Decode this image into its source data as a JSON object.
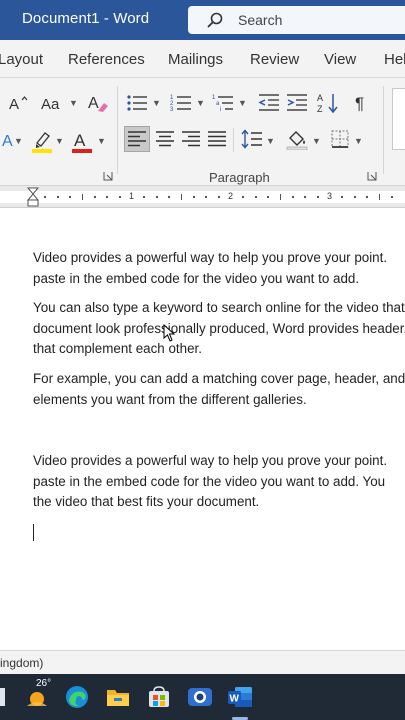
{
  "titlebar": {
    "title": "Document1 - Word",
    "search_placeholder": "Search"
  },
  "tabs": [
    "Layout",
    "References",
    "Mailings",
    "Review",
    "View",
    "Help"
  ],
  "ribbon": {
    "paragraph_group_label": "Paragraph"
  },
  "ruler": {
    "numbers": [
      "1",
      "2",
      "3"
    ]
  },
  "document": {
    "paragraphs": [
      [
        "Video provides a powerful way to help you prove your point.",
        "paste in the embed code for the video you want to add."
      ],
      [
        "You can also type a keyword to search online for the video that",
        "document look professionally produced, Word provides header,",
        "that complement each other."
      ],
      [
        "For example, you can add a matching cover page, header, and",
        "elements you want from the different galleries."
      ],
      [
        "Video provides a powerful way to help you prove your point.",
        "paste in the embed code for the video you want to add. You",
        "the video that best fits your document."
      ]
    ]
  },
  "statusbar": {
    "language": "ingdom)"
  },
  "taskbar": {
    "weather_temp": "26°"
  },
  "colors": {
    "title_blue": "#2b579a",
    "highlight_yellow": "#ffe400",
    "font_red": "#d9221a"
  }
}
